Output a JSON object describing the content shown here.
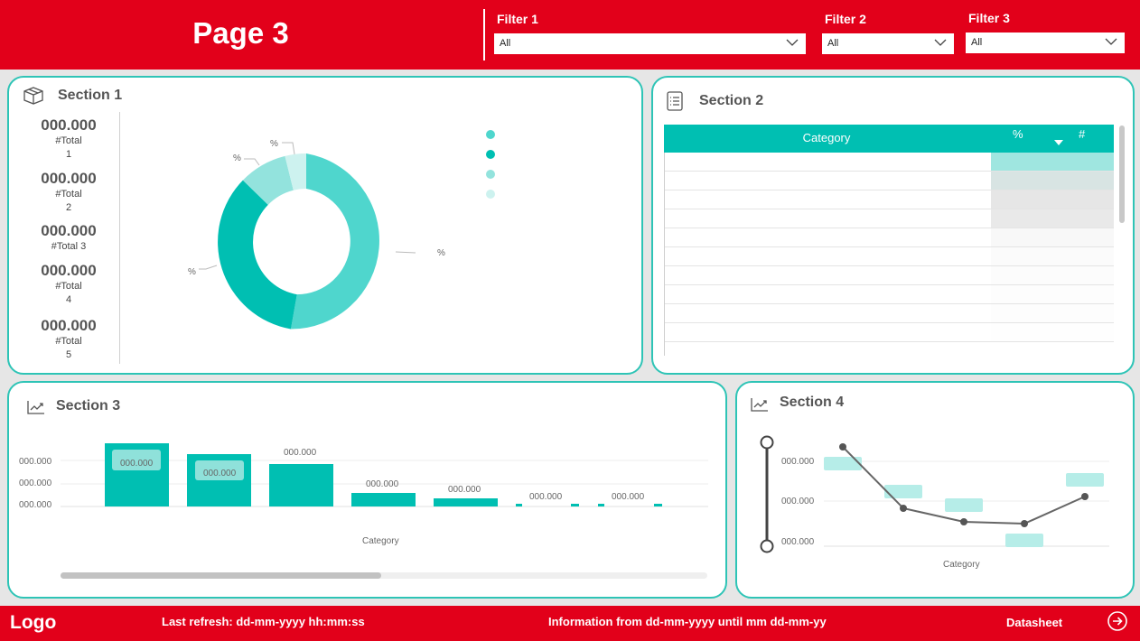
{
  "header": {
    "title": "Page 3",
    "filters": [
      {
        "label": "Filter 1",
        "value": "All"
      },
      {
        "label": "Filter 2",
        "value": "All"
      },
      {
        "label": "Filter 3",
        "value": "All"
      }
    ]
  },
  "section1": {
    "title": "Section 1",
    "kpis": [
      {
        "value": "000.000",
        "label_line1": "#Total",
        "label_line2": "1"
      },
      {
        "value": "000.000",
        "label_line1": "#Total",
        "label_line2": "2"
      },
      {
        "value": "000.000",
        "label_line1": "#Total 3",
        "label_line2": ""
      },
      {
        "value": "000.000",
        "label_line1": "#Total",
        "label_line2": "4"
      },
      {
        "value": "000.000",
        "label_line1": "#Total",
        "label_line2": "5"
      }
    ],
    "donut_labels": [
      "%",
      "%",
      "%",
      "%"
    ],
    "legend_colors": [
      "#4fd6cd",
      "#00bfb2",
      "#93e3dd",
      "#cdf2ef"
    ]
  },
  "section2": {
    "title": "Section 2",
    "columns": [
      "Category",
      "%",
      "#"
    ]
  },
  "section3": {
    "title": "Section 3",
    "y_ticks": [
      "000.000",
      "000.000",
      "000.000"
    ],
    "bar_labels": [
      "000.000",
      "000.000",
      "000.000",
      "000.000",
      "000.000",
      "000.000",
      "000.000"
    ],
    "x_axis_label": "Category"
  },
  "section4": {
    "title": "Section 4",
    "y_ticks": [
      "000.000",
      "000.000",
      "000.000"
    ],
    "x_axis_label": "Category"
  },
  "footer": {
    "logo": "Logo",
    "last_refresh": "Last refresh: dd-mm-yyyy hh:mm:ss",
    "info_range": "Information from dd-mm-yyyy until mm dd-mm-yy",
    "datasheet": "Datasheet"
  },
  "colors": {
    "brand_red": "#e2001a",
    "teal": "#00bfb2",
    "panel_border": "#2ec4b6"
  }
}
